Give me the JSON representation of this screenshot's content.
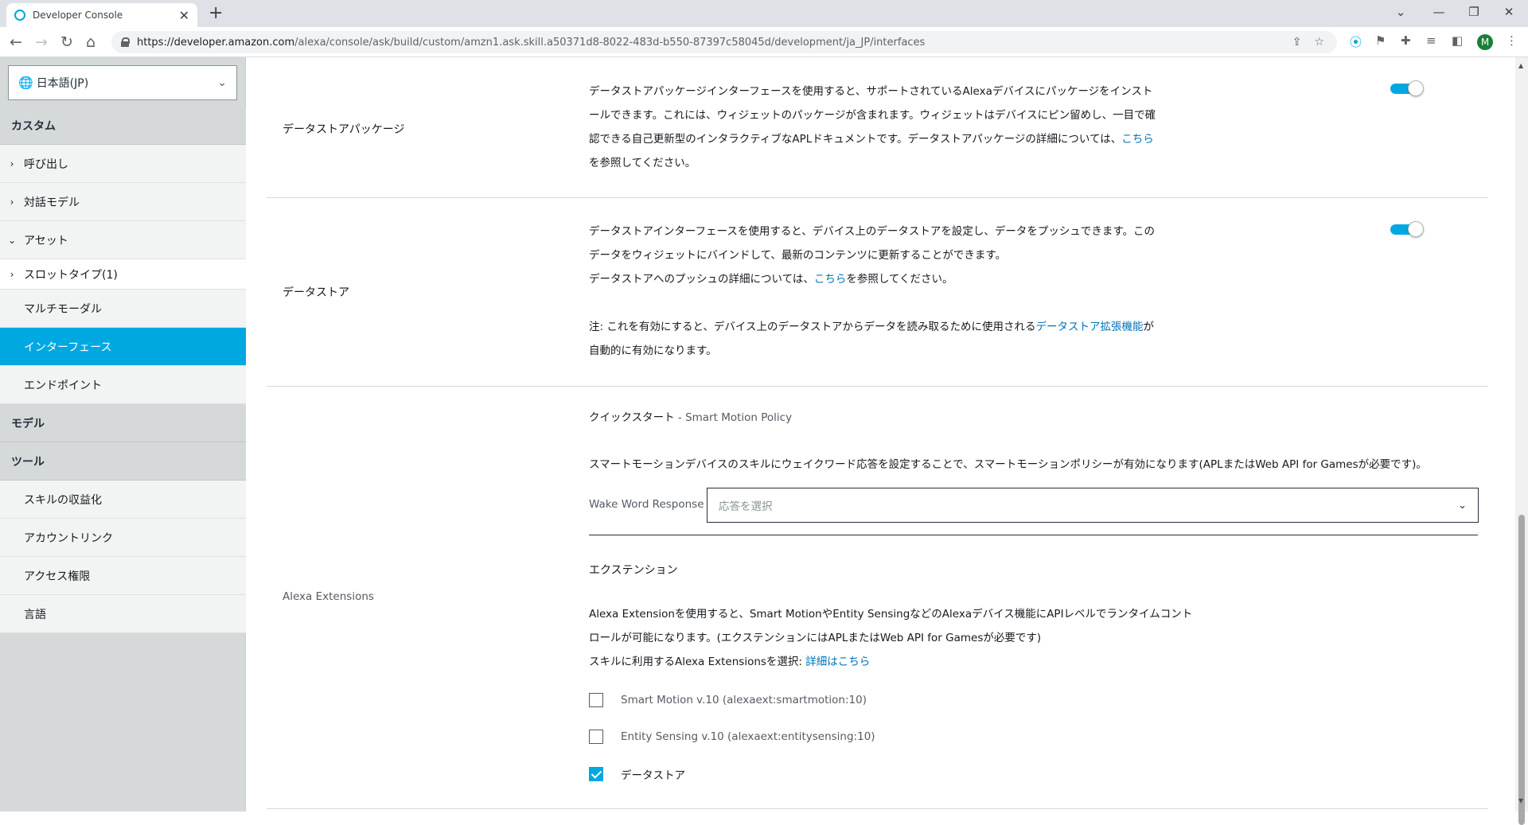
{
  "browser": {
    "tab_title": "Developer Console",
    "tab_close": "✕",
    "new_tab": "+",
    "url_host": "https://developer.amazon.com",
    "url_path": "/alexa/console/ask/build/custom/amzn1.ask.skill.a50371d8-8022-483d-b550-87397c58045d/development/ja_JP/interfaces",
    "avatar_letter": "M"
  },
  "sidebar": {
    "language": "日本語(JP)",
    "sections": {
      "custom": "カスタム",
      "model": "モデル",
      "tools": "ツール"
    },
    "items": [
      {
        "label": "呼び出し",
        "arrow": "›"
      },
      {
        "label": "対話モデル",
        "arrow": "›"
      },
      {
        "label": "アセット",
        "arrow": "⌄"
      },
      {
        "label": "スロットタイプ(1)",
        "arrow": "›"
      },
      {
        "label": "マルチモーダル"
      },
      {
        "label": "インターフェース"
      },
      {
        "label": "エンドポイント"
      },
      {
        "label": "スキルの収益化"
      },
      {
        "label": "アカウントリンク"
      },
      {
        "label": "アクセス権限"
      },
      {
        "label": "言語"
      }
    ]
  },
  "main": {
    "datastore_package": {
      "title": "データストアパッケージ",
      "line1": "データストアパッケージインターフェースを使用すると、サポートされているAlexaデバイスにパッケージをインスト",
      "line2": "ールできます。これには、ウィジェットのパッケージが含まれます。ウィジェットはデバイスにピン留めし、一目で確",
      "line3a": "認できる自己更新型のインタラクティブなAPLドキュメントです。データストアパッケージの詳細については、",
      "link": "こちら",
      "line4": "を参照してください。",
      "enabled": true
    },
    "datastore": {
      "title": "データストア",
      "line1": "データストアインターフェースを使用すると、デバイス上のデータストアを設定し、データをプッシュできます。この",
      "line2": "データをウィジェットにバインドして、最新のコンテンツに更新することができます。",
      "line3a": "データストアへのプッシュの詳細については、",
      "link": "こちら",
      "line3b": "を参照してください。",
      "note_a": "注: これを有効にすると、デバイス上のデータストアからデータを読み取るために使用される",
      "note_link": "データストア拡張機能",
      "note_b": "が",
      "note_line2": "自動的に有効になります。",
      "enabled": true
    },
    "alexa_extensions": {
      "title": "Alexa Extensions",
      "quickstart_a": "クイックスタート",
      "quickstart_b": " - Smart Motion Policy",
      "smart_motion_desc": "スマートモーションデバイスのスキルにウェイクワード応答を設定することで、スマートモーションポリシーが有効になります(APLまたはWeb API for Gamesが必要です)。",
      "wwr_label": "Wake Word Response",
      "wwr_placeholder": "応答を選択",
      "ext_heading": "エクステンション",
      "ext_line1": "Alexa Extensionを使用すると、Smart MotionやEntity SensingなどのAlexaデバイス機能にAPIレベルでランタイムコント",
      "ext_line2": "ロールが可能になります。(エクステンションにはAPLまたはWeb API for Gamesが必要です)",
      "ext_line3a": "スキルに利用するAlexa Extensionsを選択: ",
      "ext_link": "詳細はこちら",
      "checkboxes": [
        {
          "label": "Smart Motion v.10 (alexaext:smartmotion:10)",
          "checked": false
        },
        {
          "label": "Entity Sensing v.10 (alexaext:entitysensing:10)",
          "checked": false
        },
        {
          "label": "データストア",
          "checked": true
        }
      ]
    }
  },
  "colors": {
    "accent": "#00a8e1",
    "link": "#0073bb",
    "sidebar_bg": "#d5d9d9"
  }
}
